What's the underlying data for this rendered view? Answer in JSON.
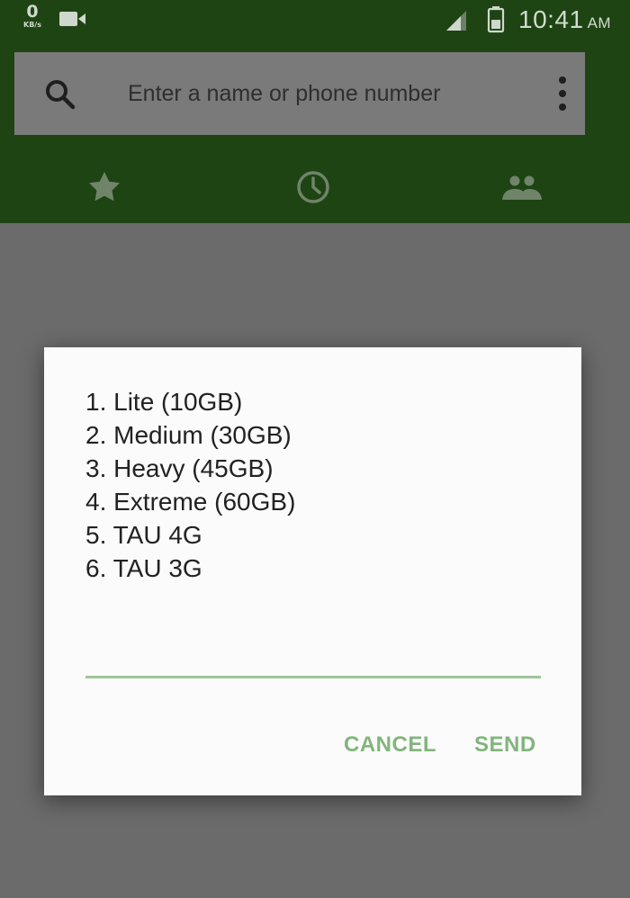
{
  "status_bar": {
    "net_speed_value": "0",
    "net_speed_unit": "KB/s",
    "time": "10:41",
    "ampm": "AM"
  },
  "search": {
    "placeholder": "Enter a name or phone number",
    "icon": "search-icon",
    "more_icon": "more-vert-icon"
  },
  "tabs": [
    {
      "name": "favorites",
      "icon": "star-icon"
    },
    {
      "name": "recents",
      "icon": "clock-icon"
    },
    {
      "name": "contacts",
      "icon": "people-icon"
    }
  ],
  "dialog": {
    "menu": [
      "1. Lite (10GB)",
      "2. Medium (30GB)",
      "3. Heavy (45GB)",
      "4. Extreme (60GB)",
      "5. TAU 4G",
      "6. TAU 3G"
    ],
    "input_value": "",
    "cancel_label": "CANCEL",
    "send_label": "SEND"
  },
  "colors": {
    "header_bg": "#1e4413",
    "scrim": "#6b6b6b",
    "accent": "#82b57c"
  }
}
